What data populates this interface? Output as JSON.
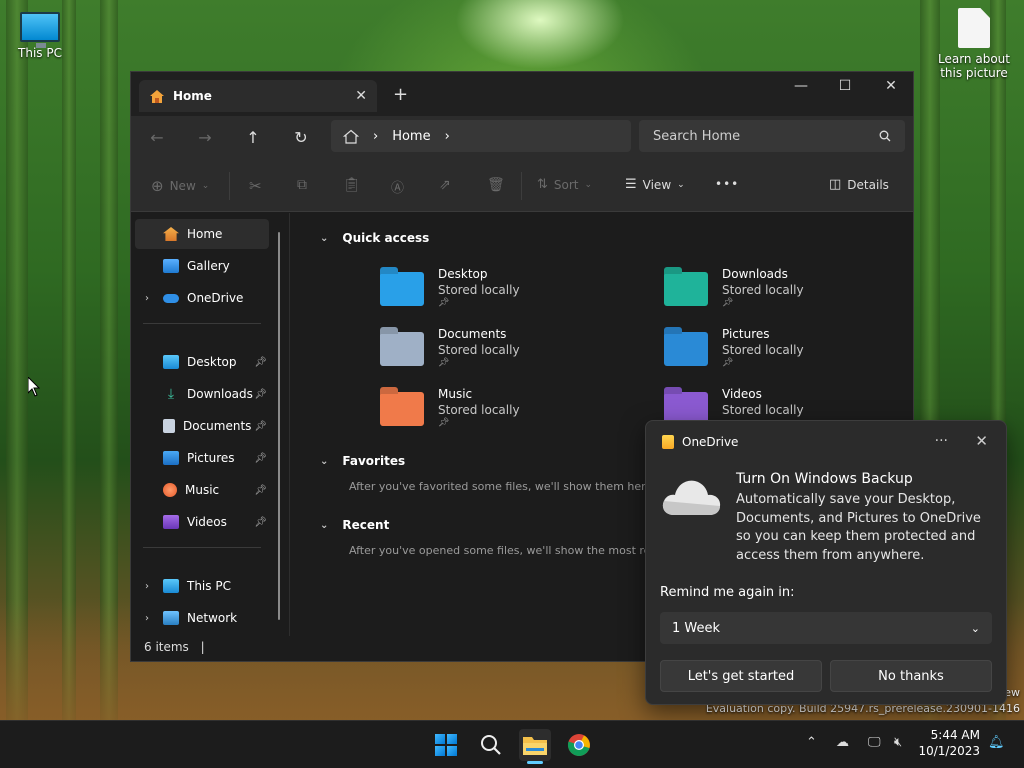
{
  "desktop": {
    "icons": [
      {
        "label": "This PC"
      },
      {
        "label": "Learn about this picture"
      }
    ],
    "watermark_line1": "ew",
    "watermark_line2": "Evaluation copy. Build 25947.rs_prerelease.230901-1416"
  },
  "explorer": {
    "tab_title": "Home",
    "tab_close": "✕",
    "new_tab": "+",
    "minimize": "—",
    "maximize": "☐",
    "close": "✕",
    "address": {
      "crumb": "Home",
      "sep": "›"
    },
    "search_placeholder": "Search Home",
    "commands": {
      "new": "New",
      "sort": "Sort",
      "view": "View",
      "more": "•••",
      "details": "Details"
    },
    "sidebar": {
      "items": [
        {
          "label": "Home"
        },
        {
          "label": "Gallery"
        },
        {
          "label": "OneDrive"
        },
        {
          "label": "Desktop"
        },
        {
          "label": "Downloads"
        },
        {
          "label": "Documents"
        },
        {
          "label": "Pictures"
        },
        {
          "label": "Music"
        },
        {
          "label": "Videos"
        },
        {
          "label": "This PC"
        },
        {
          "label": "Network"
        }
      ]
    },
    "quick_access": {
      "title": "Quick access",
      "items": [
        {
          "name": "Desktop",
          "sub": "Stored locally",
          "color": "#29a0e8"
        },
        {
          "name": "Downloads",
          "sub": "Stored locally",
          "color": "#1fb39a"
        },
        {
          "name": "Documents",
          "sub": "Stored locally",
          "color": "#9fb0c6"
        },
        {
          "name": "Pictures",
          "sub": "Stored locally",
          "color": "#2a8ad6"
        },
        {
          "name": "Music",
          "sub": "Stored locally",
          "color": "#f07a4a"
        },
        {
          "name": "Videos",
          "sub": "Stored locally",
          "color": "#8b5ad1"
        }
      ]
    },
    "favorites": {
      "title": "Favorites",
      "message": "After you've favorited some files, we'll show them here."
    },
    "recent": {
      "title": "Recent",
      "message": "After you've opened some files, we'll show the most rece"
    },
    "status": "6 items"
  },
  "toast": {
    "app": "OneDrive",
    "more": "···",
    "close": "✕",
    "title": "Turn On Windows Backup",
    "body": "Automatically save your Desktop, Documents, and Pictures to OneDrive so you can keep them protected and access them from anywhere.",
    "remind_label": "Remind me again in:",
    "remind_value": "1 Week",
    "primary_button": "Let's get started",
    "secondary_button": "No thanks"
  },
  "taskbar": {
    "time": "5:44 AM",
    "date": "10/1/2023"
  }
}
